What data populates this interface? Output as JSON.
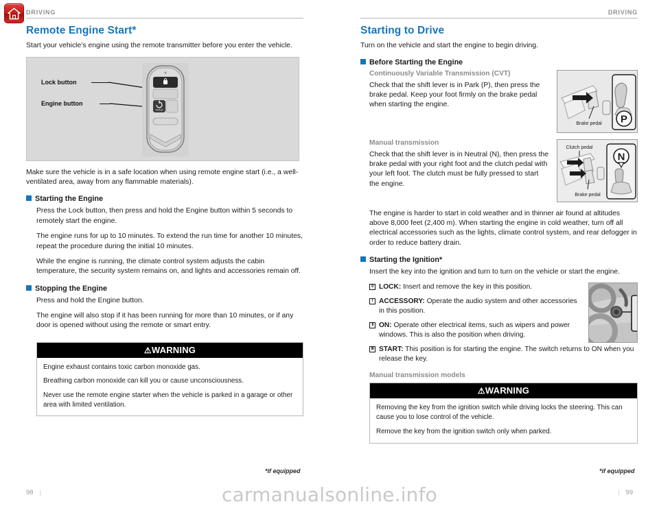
{
  "header": {
    "home_icon": "home-icon",
    "running_head_left": "DRIVING",
    "running_head_right": "DRIVING"
  },
  "left_column": {
    "title": "Remote Engine Start*",
    "intro": "Start your vehicle’s engine using the remote transmitter before you enter the vehicle.",
    "figure": {
      "name": "key-fob-diagram",
      "labels": [
        {
          "text": "Lock button"
        },
        {
          "text": "Engine button"
        }
      ],
      "fob_button_glyphs": [
        "lock-icon",
        "engine-hold-icon"
      ],
      "engine_button_caption": "HOLD"
    },
    "note": "Make sure the vehicle is in a safe location when using remote engine start (i.e., a well-ventilated area, away from any flammable materials).",
    "sections": [
      {
        "heading": "Starting the Engine",
        "paragraphs": [
          "Press the Lock button, then press and hold the Engine button within 5 seconds to remotely start the engine.",
          "The engine runs for up to 10 minutes. To extend the run time for another 10 minutes, repeat the procedure during the initial 10 minutes.",
          "While the engine is running, the climate control system adjusts the cabin temperature, the security system remains on, and lights and accessories remain off."
        ]
      },
      {
        "heading": "Stopping the Engine",
        "paragraphs": [
          "Press and hold the Engine button.",
          "The engine will also stop if it has been running for more than 10 minutes, or if any door is opened without using the remote or smart entry."
        ]
      }
    ],
    "warning": {
      "title": "WARNING",
      "triangle": "⚠",
      "paragraphs": [
        "Engine exhaust contains toxic carbon monoxide gas.",
        "Breathing carbon monoxide can kill you or cause unconsciousness.",
        "Never use the remote engine starter when the vehicle is parked in a garage or other area with limited ventilation."
      ]
    },
    "footnote": "*if equipped",
    "page_number": "98"
  },
  "right_column": {
    "title": "Starting to Drive",
    "intro": "Turn on the vehicle and start the engine to begin driving.",
    "before_starting": {
      "heading": "Before Starting the Engine",
      "cvt": {
        "label": "Continuously Variable Transmission (CVT)",
        "text": "Check that the shift lever is in Park (P), then press the brake pedal. Keep your foot firmly on the brake pedal when starting the engine.",
        "figure": {
          "name": "brake-pedal-park-diagram",
          "caption": "Brake pedal",
          "gear_letter": "P"
        }
      },
      "manual": {
        "label": "Manual transmission",
        "text": "Check that the shift lever is in Neutral (N), then press the brake pedal with your right foot and the clutch pedal with your left foot. The clutch must be fully pressed to start the engine.",
        "figure": {
          "name": "clutch-brake-neutral-diagram",
          "caption_top": "Clutch pedal",
          "caption_bottom": "Brake pedal",
          "gear_letter": "N"
        }
      },
      "cold_weather": "The engine is harder to start in cold weather and in thinner air found at altitudes above 8,000 feet (2,400 m). When starting the engine in cold weather, turn off all electrical accessories such as the lights, climate control system, and rear defogger in order to reduce battery drain."
    },
    "starting_ignition": {
      "heading": "Starting the Ignition*",
      "intro": "Insert the key into the ignition and turn to turn on the vehicle or start the engine.",
      "figure": {
        "name": "ignition-switch-photo"
      },
      "positions": [
        {
          "glyph": "0",
          "term": "LOCK:",
          "text": " Insert and remove the key in this position."
        },
        {
          "glyph": "I",
          "term": "ACCESSORY:",
          "text": " Operate the audio system and other accessories in this position."
        },
        {
          "glyph": "II",
          "term": "ON:",
          "text": " Operate other electrical items, such as wipers and power windows. This is also the position when driving."
        },
        {
          "glyph": "III",
          "term": "START:",
          "text": " This position is for starting the engine. The switch returns to ON when you release the key."
        }
      ],
      "manual_models_label": "Manual transmission models"
    },
    "warning": {
      "title": "WARNING",
      "triangle": "⚠",
      "paragraphs": [
        "Removing the key from the ignition switch while driving locks the steering. This can cause you to lose control of the vehicle.",
        "Remove the key from the ignition switch only when parked."
      ]
    },
    "footnote": "*if equipped",
    "page_number": "99"
  },
  "watermark": "carmanualsonline.info"
}
